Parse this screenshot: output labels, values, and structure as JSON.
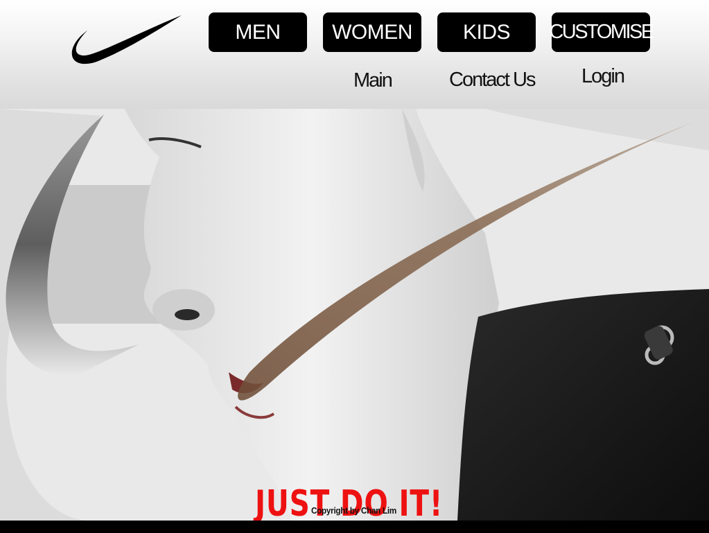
{
  "brand": {
    "logo_icon": "swoosh-logo-icon"
  },
  "nav": {
    "buttons": [
      {
        "label": "MEN"
      },
      {
        "label": "WOMEN"
      },
      {
        "label": "KIDS"
      },
      {
        "label": "CUSTOMISE"
      }
    ],
    "links": [
      {
        "label": "Main"
      },
      {
        "label": "Contact Us"
      },
      {
        "label": "Login"
      }
    ]
  },
  "hero": {
    "slogan": "JUST DO IT!",
    "slogan_color": "#ee1111",
    "swoosh_overlay_color": "#7a5c45"
  },
  "footer": {
    "copyright": "Copyright by Chan Lim"
  }
}
